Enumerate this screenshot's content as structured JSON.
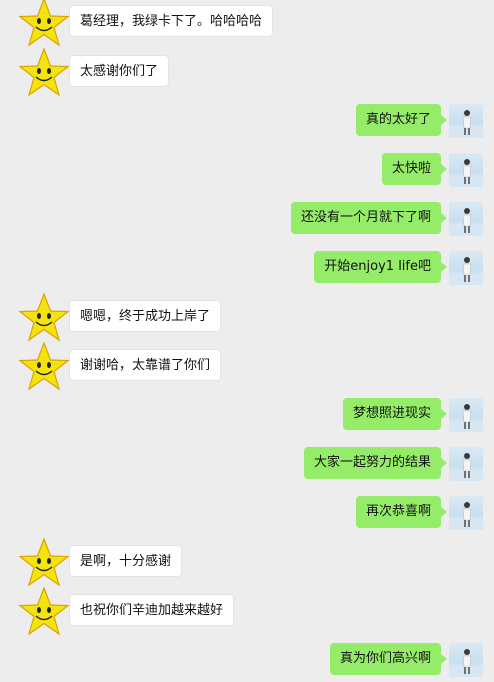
{
  "messages": [
    {
      "side": "left",
      "text": "葛经理，我绿卡下了。哈哈哈哈"
    },
    {
      "side": "left",
      "text": "太感谢你们了"
    },
    {
      "side": "right",
      "text": "真的太好了"
    },
    {
      "side": "right",
      "text": "太快啦"
    },
    {
      "side": "right",
      "text": "还没有一个月就下了啊"
    },
    {
      "side": "right",
      "text": "开始enjoy1 life吧"
    },
    {
      "side": "left",
      "text": "嗯嗯，终于成功上岸了"
    },
    {
      "side": "left",
      "text": "谢谢哈，太靠谱了你们"
    },
    {
      "side": "right",
      "text": "梦想照进现实"
    },
    {
      "side": "right",
      "text": "大家一起努力的结果"
    },
    {
      "side": "right",
      "text": "再次恭喜啊"
    },
    {
      "side": "left",
      "text": "是啊，十分感谢"
    },
    {
      "side": "left",
      "text": "也祝你们辛迪加越来越好"
    },
    {
      "side": "right",
      "text": "真为你们高兴啊"
    }
  ],
  "avatars": {
    "left": "star-smiley-icon",
    "right": "person-photo-avatar"
  },
  "colors": {
    "background": "#ededed",
    "left_bubble": "#ffffff",
    "right_bubble": "#95ec69",
    "star_fill": "#f5e30d",
    "star_stroke": "#d9a400"
  }
}
